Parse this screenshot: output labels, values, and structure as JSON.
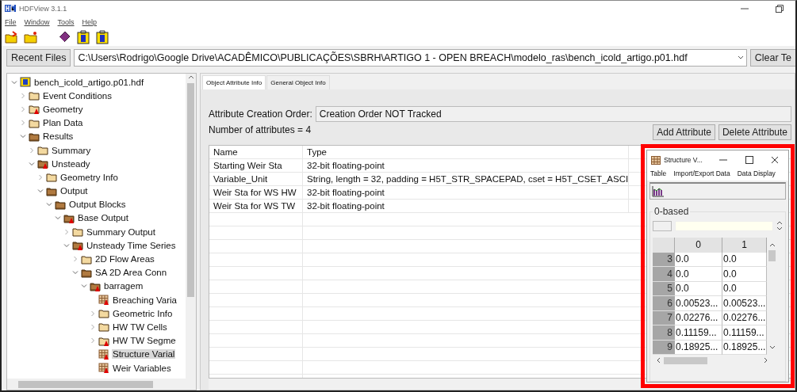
{
  "window": {
    "title": "HDFView 3.1.1"
  },
  "menu": [
    "File",
    "Window",
    "Tools",
    "Help"
  ],
  "recent_files": {
    "button": "Recent Files",
    "path": "C:\\Users\\Rodrigo\\Google Drive\\ACADÊMICO\\PUBLICAÇÕES\\SBRH\\ARTIGO 1 - OPEN BREACH\\modelo_ras\\bench_icold_artigo.p01.hdf",
    "clear_button": "Clear Te"
  },
  "tree": {
    "items": [
      {
        "label": "bench_icold_artigo.p01.hdf",
        "kind": "file",
        "expanded": true,
        "has_attributes": false,
        "selected": false,
        "children": [
          {
            "label": "Event Conditions",
            "kind": "group",
            "expanded": false,
            "has_attributes": false,
            "selected": false
          },
          {
            "label": "Geometry",
            "kind": "group",
            "expanded": false,
            "has_attributes": true,
            "selected": false
          },
          {
            "label": "Plan Data",
            "kind": "group",
            "expanded": false,
            "has_attributes": false,
            "selected": false
          },
          {
            "label": "Results",
            "kind": "group",
            "expanded": true,
            "has_attributes": false,
            "selected": false,
            "children": [
              {
                "label": "Summary",
                "kind": "group",
                "expanded": false,
                "has_attributes": false,
                "selected": false
              },
              {
                "label": "Unsteady",
                "kind": "group",
                "expanded": true,
                "has_attributes": true,
                "selected": false,
                "children": [
                  {
                    "label": "Geometry Info",
                    "kind": "group",
                    "expanded": false,
                    "has_attributes": false,
                    "selected": false
                  },
                  {
                    "label": "Output",
                    "kind": "group",
                    "expanded": true,
                    "has_attributes": false,
                    "selected": false,
                    "children": [
                      {
                        "label": "Output Blocks",
                        "kind": "group",
                        "expanded": true,
                        "has_attributes": false,
                        "selected": false,
                        "children": [
                          {
                            "label": "Base Output",
                            "kind": "group",
                            "expanded": true,
                            "has_attributes": true,
                            "selected": false,
                            "children": [
                              {
                                "label": "Summary Output",
                                "kind": "group",
                                "expanded": false,
                                "has_attributes": false,
                                "selected": false
                              },
                              {
                                "label": "Unsteady Time Series",
                                "kind": "group",
                                "expanded": true,
                                "has_attributes": true,
                                "selected": false,
                                "children": [
                                  {
                                    "label": "2D Flow Areas",
                                    "kind": "group",
                                    "expanded": false,
                                    "has_attributes": false,
                                    "selected": false
                                  },
                                  {
                                    "label": "SA 2D Area Conn",
                                    "kind": "group",
                                    "expanded": true,
                                    "has_attributes": false,
                                    "selected": false,
                                    "children": [
                                      {
                                        "label": "barragem",
                                        "kind": "group",
                                        "expanded": true,
                                        "has_attributes": true,
                                        "selected": false,
                                        "children": [
                                          {
                                            "label": "Breaching Varia",
                                            "kind": "dataset",
                                            "has_attributes": true,
                                            "selected": false
                                          },
                                          {
                                            "label": "Geometric Info",
                                            "kind": "group",
                                            "expanded": false,
                                            "has_attributes": false,
                                            "selected": false
                                          },
                                          {
                                            "label": "HW TW Cells",
                                            "kind": "group",
                                            "expanded": false,
                                            "has_attributes": false,
                                            "selected": false
                                          },
                                          {
                                            "label": "HW TW Segme",
                                            "kind": "group",
                                            "expanded": false,
                                            "has_attributes": true,
                                            "selected": false
                                          },
                                          {
                                            "label": "Structure Varial",
                                            "kind": "dataset",
                                            "has_attributes": true,
                                            "selected": true
                                          },
                                          {
                                            "label": "Weir Variables",
                                            "kind": "dataset",
                                            "has_attributes": true,
                                            "selected": false
                                          }
                                        ]
                                      }
                                    ]
                                  }
                                ]
                              }
                            ]
                          }
                        ]
                      }
                    ]
                  }
                ]
              }
            ]
          }
        ]
      }
    ]
  },
  "tabs": [
    {
      "label": "Object Attribute Info",
      "selected": true
    },
    {
      "label": "General Object Info",
      "selected": false
    }
  ],
  "creation_order": {
    "label": "Attribute Creation Order:",
    "value": "Creation Order NOT Tracked"
  },
  "attribute_count": "Number of attributes = 4",
  "buttons": [
    "Add Attribute",
    "Delete Attribute"
  ],
  "attributes": {
    "columns": [
      "Name",
      "Type"
    ],
    "rows": [
      [
        "Starting Weir Sta",
        "32-bit floating-point"
      ],
      [
        "Variable_Unit",
        "String, length = 32, padding = H5T_STR_SPACEPAD, cset = H5T_CSET_ASCI"
      ],
      [
        "Weir Sta for WS HW",
        "32-bit floating-point"
      ],
      [
        "Weir Sta for WS TW",
        "32-bit floating-point"
      ]
    ]
  },
  "data_window": {
    "title": "Structure V...",
    "menu": [
      "Table",
      "Import/Export Data",
      "Data Display"
    ],
    "index_base": "0-based",
    "table": {
      "columns": [
        "0",
        "1"
      ],
      "rows": [
        {
          "index": "3",
          "cells": [
            "0.0",
            "0.0"
          ]
        },
        {
          "index": "4",
          "cells": [
            "0.0",
            "0.0"
          ]
        },
        {
          "index": "5",
          "cells": [
            "0.0",
            "0.0"
          ]
        },
        {
          "index": "6",
          "cells": [
            "0.00523...",
            "0.00523..."
          ]
        },
        {
          "index": "7",
          "cells": [
            "0.02276...",
            "0.02276..."
          ]
        },
        {
          "index": "8",
          "cells": [
            "0.11159...",
            "0.11159..."
          ]
        },
        {
          "index": "9",
          "cells": [
            "0.18925...",
            "0.18925..."
          ]
        }
      ]
    }
  }
}
